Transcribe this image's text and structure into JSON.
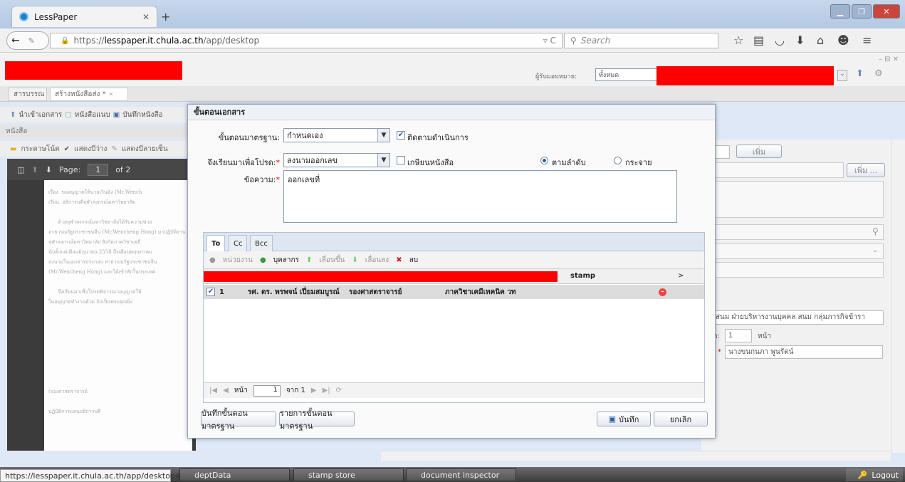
{
  "browser": {
    "tab_title": "LessPaper",
    "url_prefix": "https://",
    "url_host": "lesspaper.it.chula.ac.th",
    "url_path": "/app/desktop",
    "search_placeholder": "Search",
    "status_url": "https://lesspaper.it.chula.ac.th/app/desktop#"
  },
  "app": {
    "recipient_label": "ผู้รับมอบหมาย:",
    "recipient_value": "ทั้งหมด",
    "tabs": [
      "สารบรรณ",
      "สร้างหนังสือส่ง *"
    ],
    "toolbar": [
      "นำเข้าเอกสาร",
      "หนังสือแนบ",
      "บันทึกหนังสือ"
    ],
    "section_title": "หนังสือ",
    "doc_toolbar": [
      "กระดาษโน้ต",
      "แสดงบีว่าง",
      "แสดงบีลายเซ็น"
    ],
    "pdf": {
      "page_label": "Page:",
      "page": "1",
      "of": "of 2"
    },
    "pdf_text": "เรื่อง  ขออนุญาตให้นายเวินฉัง (Mr.Wench\nเรียน  อธิการบดีจุฬาลงกรณ์มหาวิทยาลัย\n\n      ด้วยจุฬาลงกรณ์มหาวิทยาลัยได้รับความช่วย\nสาธารณรัฐประชาชนจีน (Mr.Wencheng Hong) มาปฏิบัติงาน\nจุฬาลงกรณ์มหาวิทยาลัย สังกัดภาควิชาเคมี\nนับตั้งแต่เดือนมิถุนายน 2558 ถึงเดือนพฤษภาคม\nลงนามในเอกสารประกอบ สาธารณรัฐประชาชนจีน\n(Mr.Wencheng Hong) และได้เข้าพักในประเทศ\n\n      จึงเรียนมาเพื่อโปรดพิจารณาอนุญาตให้\nในอนุญาตทำงานด้วย จักเป็นพระคุณยิ่ง\n\n\n\n\n\n\n\n\n(รองศาสตราจารย์\n\nปฏิบัติการแทนอธิการบดี",
    "right_panel": {
      "add_button": "เพิ่ม",
      "add_button2": "เพิ่ม ...",
      "dept_text": "ชย์ สนม ฝ่ายบริหารงานบุคคล สนม กลุ่มภารกิจข้ารา",
      "pages_label": "า:",
      "pages_value": "1",
      "pages_unit": "หน้า",
      "owner_label": "*",
      "owner_value": "นางขนกนภา พูนรัตน์"
    },
    "taskbar": [
      "deptData",
      "stamp store",
      "document inspector"
    ],
    "logout": "Logout"
  },
  "modal": {
    "title": "ขั้นตอนเอกสาร",
    "std_step_label": "ขั้นตอนมาตรฐาน:",
    "std_step_value": "กำหนดเอง",
    "track_label": "ติดตามดำเนินการ",
    "purpose_label": "จึงเรียนมาเพื่อโปรด:",
    "purpose_value": "ลงนามออกเลข",
    "circulate_label": "เกษียนหนังสือ",
    "radio_sequence": "ตามลำดับ",
    "radio_scatter": "กระจาย",
    "message_label": "ข้อความ:",
    "message_value": "ออกเลขที่",
    "tabs": [
      "To",
      "Cc",
      "Bcc"
    ],
    "grid_toolbar": [
      "หน่วยงาน",
      "บุคลากร",
      "เลื่อนขึ้น",
      "เลื่อนลง",
      "ลบ"
    ],
    "grid_header_stamp": "stamp",
    "grid_header_more": ">",
    "row": {
      "no": "1",
      "name": "รศ. ดร. พรพจน์ เปี่ยมสมบูรณ์",
      "position": "รองศาสตราจารย์",
      "dept": "ภาควิชาเคมีเทคนิค วท"
    },
    "pager": {
      "label": "หน้า",
      "page": "1",
      "of": "จาก 1"
    },
    "btn_save_std": "บันทึกขั้นตอนมาตรฐาน",
    "btn_list_std": "รายการขั้นตอนมาตรฐาน",
    "btn_save": "บันทึก",
    "btn_cancel": "ยกเลิก"
  }
}
